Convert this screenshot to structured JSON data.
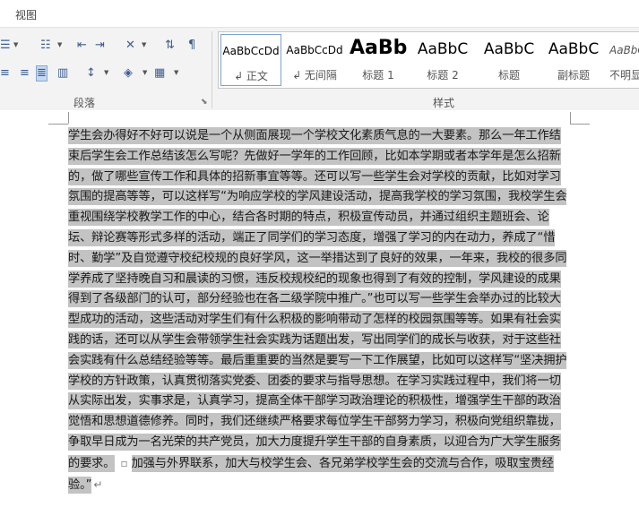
{
  "tab": {
    "view": "视图"
  },
  "groups": {
    "paragraph": "段落",
    "styles": "样式"
  },
  "styles": [
    {
      "preview": "AaBbCcDd",
      "name": "↲ 正文"
    },
    {
      "preview": "AaBbCcDd",
      "name": "↲ 无间隔"
    },
    {
      "preview": "AaBb",
      "name": "标题 1"
    },
    {
      "preview": "AaBbC",
      "name": "标题 2"
    },
    {
      "preview": "AaBbC",
      "name": "标题"
    },
    {
      "preview": "AaBbC",
      "name": "副标题"
    },
    {
      "preview": "AaBbCc",
      "name": "不明显"
    }
  ],
  "document": {
    "text": "学生会办得好不好可以说是一个从侧面展现一个学校文化素质气息的一大要素。那么一年工作结束后学生会工作总结该怎么写呢？先做好一学年的工作回顾，比如本学期或者本学年是怎么招新的，做了哪些宣传工作和具体的招新事宜等等。还可以写一些学生会对学校的贡献，比如对学习氛围的提高等等，可以这样写“为响应学校的学风建设活动，提高我学校的学习氛围，我校学生会重视围绕学校教学工作的中心，结合各时期的特点，积极宣传动员，并通过组织主题班会、论坛、辩论赛等形式多样的活动，端正了同学们的学习态度，增强了学习的内在动力，养成了“惜时、勤学”及自觉遵守校纪校规的良好学风，这一举措达到了良好的效果，一年来，我校的很多同学养成了坚持晚自习和晨读的习惯，违反校规校纪的现象也得到了有效的控制，学风建设的成果得到了各级部门的认可，部分经验也在各二级学院中推广。”也可以写一些学生会举办过的比较大型成功的活动，这些活动对学生们有什么积极的影响带动了怎样的校园氛围等等。如果有社会实践的话，还可以从学生会带领学生社会实践为话题出发，写出同学们的成长与收获，对于这些社会实践有什么总结经验等等。最后重重要的当然是要写一下工作展望，比如可以这样写“坚决拥护学校的方针政策，认真贯彻落实党委、团委的要求与指导思想。在学习实践过程中，我们将一切从实际出发，实事求是，认真学习，提高全体干部学习政治理论的积极性，增强学生干部的政治觉悟和思想道德修养。同时，我们还继续严格要求每位学生干部努力学习，积极向党组织靠拢，争取早日成为一名光荣的共产党员，加大力度提升学生干部的自身素质，以迎合为广大学生服务的要求。",
    "text_tail": "加强与外界联系，加大与校学生会、各兄弟学校学生会的交流与合作，吸取宝贵经验。”"
  }
}
